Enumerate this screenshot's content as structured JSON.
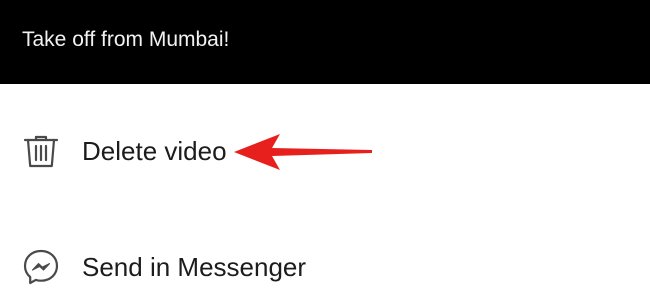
{
  "caption": {
    "text": "Take off from Mumbai!"
  },
  "menu": {
    "items": [
      {
        "label": "Delete video",
        "icon": "trash-icon"
      },
      {
        "label": "Send in Messenger",
        "icon": "messenger-icon"
      }
    ]
  },
  "colors": {
    "caption_background": "#000000",
    "caption_text": "#f2f2f2",
    "menu_text": "#1c1c1c",
    "icon_stroke": "#4a4a4a",
    "annotation_arrow": "#e8201d"
  }
}
